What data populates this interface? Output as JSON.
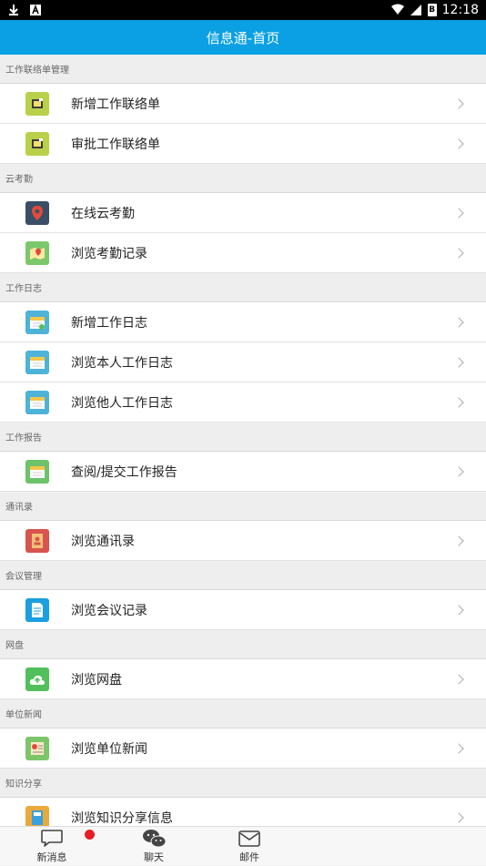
{
  "status_bar": {
    "time": "12:18",
    "battery_label": "B"
  },
  "header": {
    "title": "信息通-首页"
  },
  "sections": [
    {
      "title": "工作联络单管理",
      "items": [
        {
          "label": "新增工作联络单",
          "icon": "new-liaison-icon",
          "color": "#b8d04a"
        },
        {
          "label": "审批工作联络单",
          "icon": "approve-liaison-icon",
          "color": "#b8d04a"
        }
      ]
    },
    {
      "title": "云考勤",
      "items": [
        {
          "label": "在线云考勤",
          "icon": "location-pin-icon",
          "color": "#3a4f66"
        },
        {
          "label": "浏览考勤记录",
          "icon": "map-icon",
          "color": "#7bc86c"
        }
      ]
    },
    {
      "title": "工作日志",
      "items": [
        {
          "label": "新增工作日志",
          "icon": "calendar-add-icon",
          "color": "#4eb3d8"
        },
        {
          "label": "浏览本人工作日志",
          "icon": "calendar-icon",
          "color": "#4eb3d8"
        },
        {
          "label": "浏览他人工作日志",
          "icon": "calendar-icon",
          "color": "#4eb3d8"
        }
      ]
    },
    {
      "title": "工作报告",
      "items": [
        {
          "label": "查阅/提交工作报告",
          "icon": "report-icon",
          "color": "#6cc36a"
        }
      ]
    },
    {
      "title": "通讯录",
      "items": [
        {
          "label": "浏览通讯录",
          "icon": "contacts-book-icon",
          "color": "#d9534f"
        }
      ]
    },
    {
      "title": "会议管理",
      "items": [
        {
          "label": "浏览会议记录",
          "icon": "document-icon",
          "color": "#1a9fe0"
        }
      ]
    },
    {
      "title": "网盘",
      "items": [
        {
          "label": "浏览网盘",
          "icon": "cloud-upload-icon",
          "color": "#52c05a"
        }
      ]
    },
    {
      "title": "单位新闻",
      "items": [
        {
          "label": "浏览单位新闻",
          "icon": "news-icon",
          "color": "#7cc66a"
        }
      ]
    },
    {
      "title": "知识分享",
      "items": [
        {
          "label": "浏览知识分享信息",
          "icon": "book-icon",
          "color": "#e9a93b"
        }
      ]
    }
  ],
  "bottom_nav": [
    {
      "label": "新消息",
      "icon": "chat-bubble-icon",
      "has_badge": true
    },
    {
      "label": "聊天",
      "icon": "wechat-icon",
      "has_badge": false
    },
    {
      "label": "邮件",
      "icon": "mail-icon",
      "has_badge": false
    }
  ]
}
